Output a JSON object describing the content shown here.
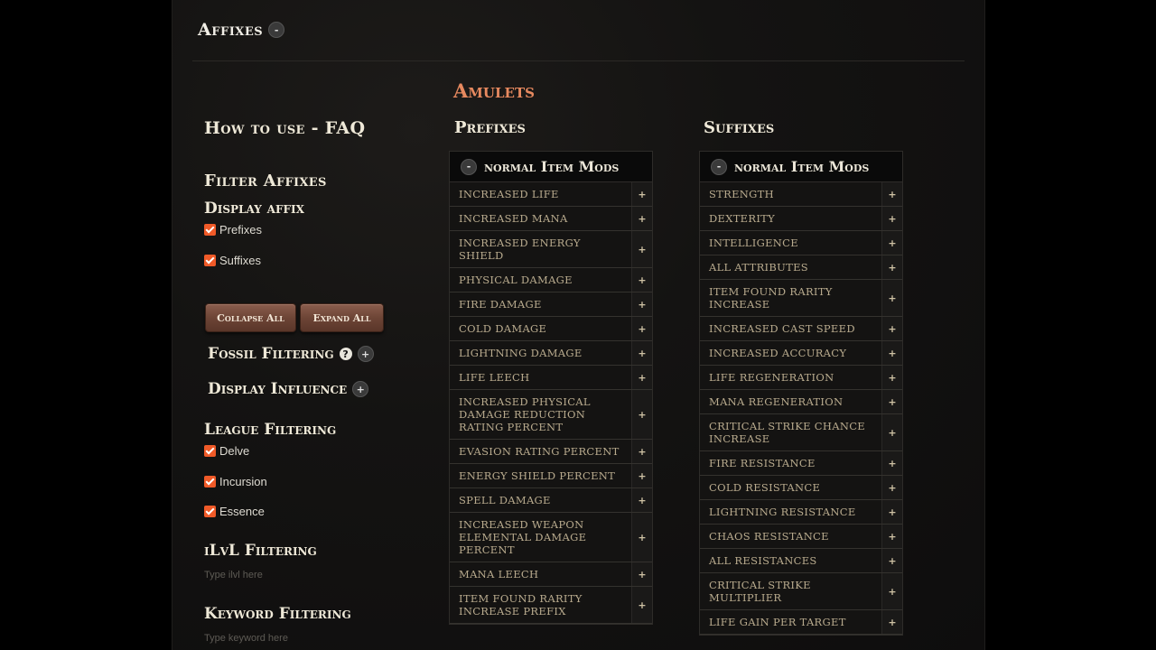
{
  "header": {
    "title": "Affixes",
    "toggle": "-"
  },
  "sidebar": {
    "faq": "How to use - FAQ",
    "filter_affixes": "Filter Affixes",
    "display_affix": "Display affix",
    "prefixes_label": "Prefixes",
    "suffixes_label": "Suffixes",
    "collapse_all": "Collapse All",
    "expand_all": "Expand All",
    "fossil_filtering": "Fossil Filtering",
    "display_influence": "Display Influence",
    "league_filtering": "League Filtering",
    "leagues": [
      "Delve",
      "Incursion",
      "Essence"
    ],
    "ilvl_filtering": "iLvL Filtering",
    "ilvl_placeholder": "Type ilvl here",
    "keyword_filtering": "Keyword Filtering",
    "keyword_placeholder": "Type keyword here"
  },
  "main": {
    "category": "Amulets",
    "prefixes": {
      "title": "Prefixes",
      "group": "normal Item Mods",
      "mods": [
        "Increased Life",
        "Increased Mana",
        "Increased Energy Shield",
        "Physical Damage",
        "Fire Damage",
        "Cold Damage",
        "Lightning Damage",
        "Life Leech",
        "Increased Physical Damage Reduction Rating Percent",
        "Evasion Rating Percent",
        "Energy Shield Percent",
        "Spell Damage",
        "Increased Weapon Elemental Damage Percent",
        "Mana Leech",
        "Item Found Rarity Increase Prefix"
      ]
    },
    "suffixes": {
      "title": "Suffixes",
      "group": "normal Item Mods",
      "mods": [
        "Strength",
        "Dexterity",
        "Intelligence",
        "All Attributes",
        "Item Found Rarity Increase",
        "Increased Cast Speed",
        "Increased Accuracy",
        "Life Regeneration",
        "Mana Regeneration",
        "Critical Strike Chance Increase",
        "Fire Resistance",
        "Cold Resistance",
        "Lightning Resistance",
        "Chaos Resistance",
        "All Resistances",
        "Critical Strike Multiplier",
        "Life Gain Per Target"
      ]
    }
  }
}
